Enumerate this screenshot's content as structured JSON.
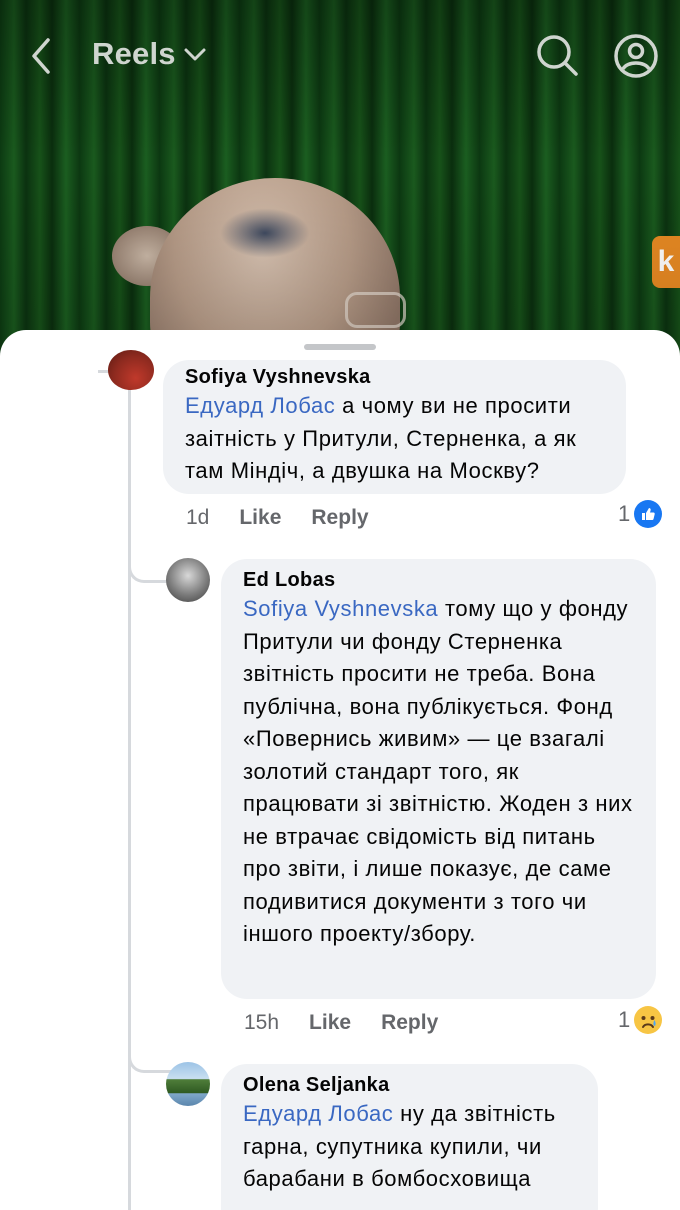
{
  "header": {
    "title": "Reels"
  },
  "comments": [
    {
      "author": "Sofiya Vyshnevska",
      "mention": "Едуард Лобас",
      "text": " а чому ви не просити заітність у Притули, Стерненка, а як там Міндіч, а двушка на Москву?",
      "time": "1d",
      "like_label": "Like",
      "reply_label": "Reply",
      "reaction_count": "1",
      "reaction_icon": "like-icon"
    },
    {
      "author": "Ed Lobas",
      "mention": "Sofiya Vyshnevska",
      "text": " тому що у фонду Притули чи фонду Стерненка звітність просити не треба. Вона публічна, вона публікується. Фонд «Повернись живим» — це взагалі золотий стандарт того, як працювати зі звітністю. Жоден з них не втрачає свідомість від питань про звіти, і лише показує, де саме подивитися документи з того чи іншого проекту/збору.",
      "time": "15h",
      "like_label": "Like",
      "reply_label": "Reply",
      "reaction_count": "1",
      "reaction_icon": "sad-icon"
    },
    {
      "author": "Olena Seljanka",
      "mention": "Едуард Лобас",
      "text": " ну да звітність гарна, супутника купили, чи барабани в бомбосховища"
    }
  ],
  "colors": {
    "mention": "#3a68c2",
    "bubble": "#f0f2f5",
    "like_blue": "#1877f2",
    "sad_yellow": "#f7c544",
    "meta_gray": "#65676b"
  }
}
